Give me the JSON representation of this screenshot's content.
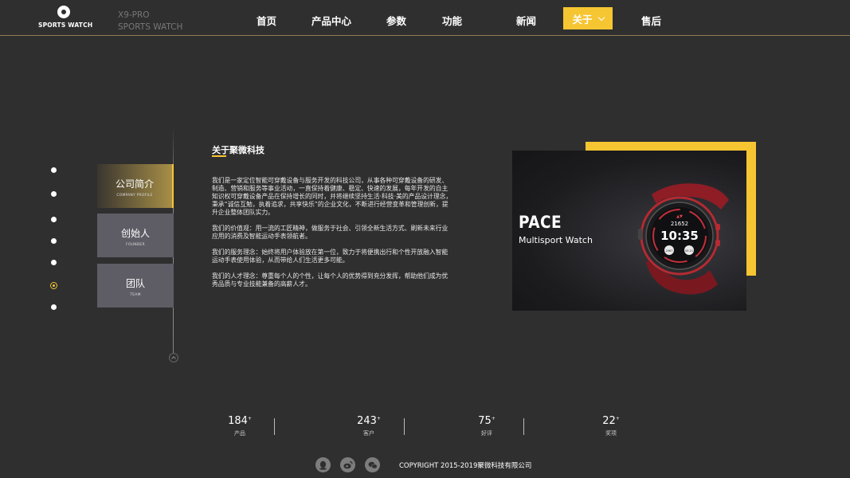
{
  "header": {
    "logo_text": "SPORTS WATCH",
    "brand_line1": "X9-PRO",
    "brand_line2": "SPORTS WATCH",
    "nav": [
      "首页",
      "产品中心",
      "参数",
      "功能",
      "新闻",
      "关于",
      "售后"
    ],
    "active_nav": "关于",
    "accent_color": "#f6c532"
  },
  "side_tabs": [
    {
      "title": "公司简介",
      "subtitle": "COMPANY PROFILE",
      "active": true
    },
    {
      "title": "创始人",
      "subtitle": "FOUNDER",
      "active": false
    },
    {
      "title": "团队",
      "subtitle": "TEAM",
      "active": false
    }
  ],
  "dot_nav": {
    "count": 7,
    "active_index": 5
  },
  "about": {
    "title": "关于聚微科技",
    "paragraphs": [
      "我们是一家定位智能可穿戴设备与服务开发的科技公司，从事各种可穿戴设备的研发、制造、营销和服务等事业活动，一直保持着健康、稳定、快速的发展，每年开发的自主知识权可穿戴设备产品在保持增长的同时，并将继续坚持生活·科技·美的产品设计理念，秉承“诚信互勉，执着追求，共享快乐”的企业文化，不断进行经营变革和管理创新，提升企业整体团队实力。",
      "我们的价值观：用一流的工匠精神，做服务于社会、引领全新生活方式、刷新未来行业应用的消费及智能运动手表领航者。",
      "我们的服务理念：始终将用户体验放在第一位，致力于将便携出行和个性开放融入智能运动手表使用体验，从而带给人们生活更多可能。",
      "我们的人才理念：尊重每个人的个性，让每个人的优势得到充分发挥，帮助他们成为优秀品质与专业技能兼备的高薪人才。"
    ]
  },
  "product": {
    "name": "PACE",
    "subtitle": "Multisport Watch",
    "watch_time": "10:35",
    "watch_top": "21652",
    "watch_left": "2567",
    "watch_right": "05:21"
  },
  "stats": [
    {
      "number": "184",
      "suffix": "+",
      "label": "产品"
    },
    {
      "number": "243",
      "suffix": "+",
      "label": "客户"
    },
    {
      "number": "75",
      "suffix": "+",
      "label": "好评"
    },
    {
      "number": "22",
      "suffix": "+",
      "label": "奖项"
    }
  ],
  "footer": {
    "social_icons": [
      "qq-icon",
      "weibo-icon",
      "wechat-icon"
    ],
    "copyright": "COPYRIGHT 2015-2019聚微科技有限公司"
  }
}
